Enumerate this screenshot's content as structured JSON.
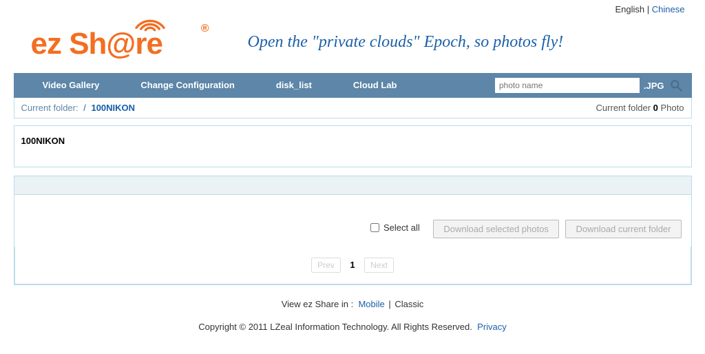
{
  "header": {
    "lang_english": "English",
    "lang_chinese": "Chinese",
    "lang_sep": "|",
    "logo_prefix": "ez Sh",
    "logo_at": "@",
    "logo_suffix": "re",
    "logo_reg": "®",
    "tagline": "Open the \"private clouds\" Epoch, so photos fly!"
  },
  "nav": {
    "items": [
      "Video Gallery",
      "Change Configuration",
      "disk_list",
      "Cloud Lab"
    ],
    "search_placeholder": "photo name",
    "search_ext": ".JPG"
  },
  "breadcrumb": {
    "label": "Current folder:",
    "slash": "/",
    "folder": "100NIKON"
  },
  "status": {
    "prefix": "Current folder",
    "count": "0",
    "suffix": "Photo"
  },
  "folder": {
    "name": "100NIKON"
  },
  "actions": {
    "select_all": "Select all",
    "download_selected": "Download selected photos",
    "download_folder": "Download current folder"
  },
  "pagination": {
    "prev": "Prev",
    "current": "1",
    "next": "Next"
  },
  "footer": {
    "view_label": "View ez Share in :",
    "mobile": "Mobile",
    "sep": "|",
    "classic": "Classic",
    "copyright": "Copyright © 2011 LZeal Information Technology. All Rights Reserved.",
    "privacy": "Privacy"
  }
}
